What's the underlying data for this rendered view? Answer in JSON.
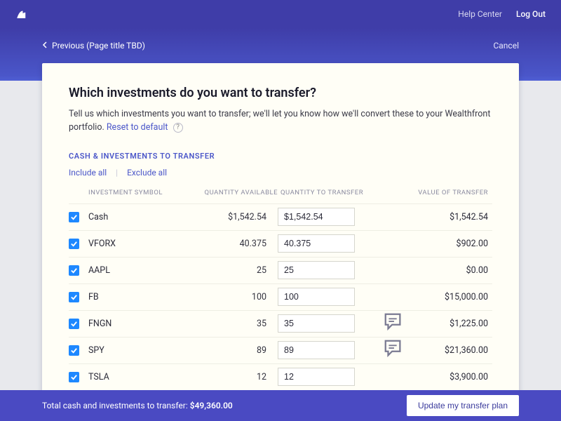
{
  "topbar": {
    "help": "Help Center",
    "logout": "Log Out"
  },
  "nav": {
    "prev": "Previous (Page title TBD)",
    "cancel": "Cancel"
  },
  "header": {
    "title": "Which investments do you want to transfer?",
    "desc1": "Tell us which investments you want to transfer; we'll let you know how we'll convert these to your Wealthfront portfolio. ",
    "reset": "Reset to default"
  },
  "section": {
    "label": "CASH & INVESTMENTS TO TRANSFER",
    "include": "Include all",
    "exclude": "Exclude all"
  },
  "cols": {
    "sym": "INVESTMENT SYMBOL",
    "qa": "QUANTITY AVAILABLE",
    "qt": "QUANTITY TO TRANSFER",
    "val": "VALUE OF TRANSFER"
  },
  "rows": [
    {
      "sym": "Cash",
      "qa": "$1,542.54",
      "qt": "$1,542.54",
      "val": "$1,542.54",
      "note": false
    },
    {
      "sym": "VFORX",
      "qa": "40.375",
      "qt": "40.375",
      "val": "$902.00",
      "note": false
    },
    {
      "sym": "AAPL",
      "qa": "25",
      "qt": "25",
      "val": "$0.00",
      "note": false
    },
    {
      "sym": "FB",
      "qa": "100",
      "qt": "100",
      "val": "$15,000.00",
      "note": false
    },
    {
      "sym": "FNGN",
      "qa": "35",
      "qt": "35",
      "val": "$1,225.00",
      "note": true
    },
    {
      "sym": "SPY",
      "qa": "89",
      "qt": "89",
      "val": "$21,360.00",
      "note": true
    },
    {
      "sym": "TSLA",
      "qa": "12",
      "qt": "12",
      "val": "$3,900.00",
      "note": false
    }
  ],
  "footer": {
    "label": "Total cash and investments to transfer: ",
    "value": "$49,360.00",
    "button": "Update my transfer plan"
  }
}
